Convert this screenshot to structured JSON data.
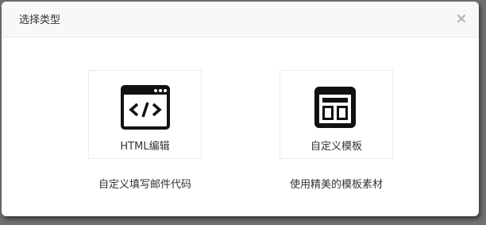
{
  "dialog": {
    "title": "选择类型",
    "close_label": "×"
  },
  "options": [
    {
      "label": "HTML编辑",
      "description": "自定义填写邮件代码",
      "icon": "code-window-icon"
    },
    {
      "label": "自定义模板",
      "description": "使用精美的模板素材",
      "icon": "layout-template-icon"
    }
  ],
  "colors": {
    "overlay": "#6f6f6f",
    "header_bg": "#f7f8fa",
    "text": "#333333",
    "icon": "#111111",
    "close": "#b4b4b4"
  }
}
